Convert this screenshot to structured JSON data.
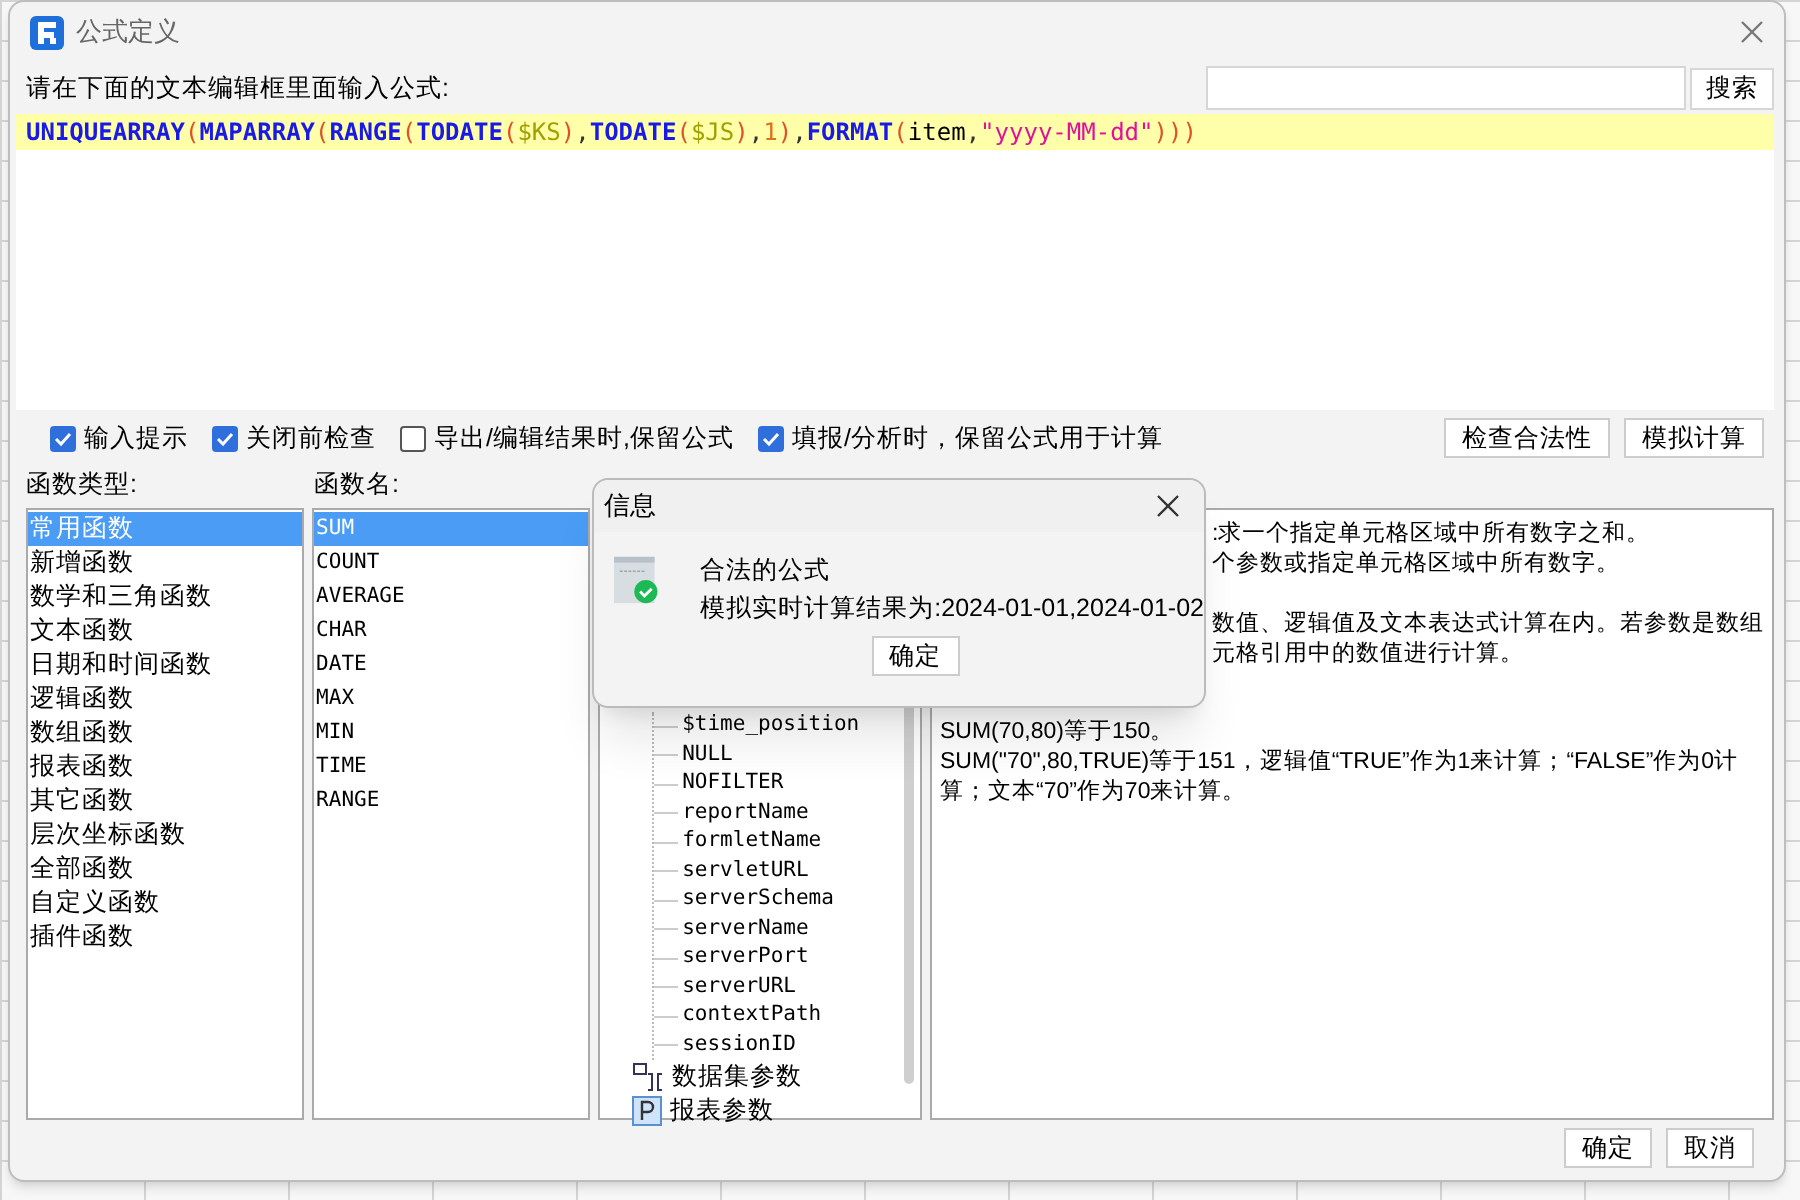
{
  "window": {
    "title": "公式定义"
  },
  "prompt": "请在下面的文本编辑框里面输入公式:",
  "search": {
    "button": "搜索"
  },
  "formula": [
    {
      "kind": "func",
      "text": "UNIQUEARRAY"
    },
    {
      "kind": "paren",
      "text": "("
    },
    {
      "kind": "func",
      "text": "MAPARRAY"
    },
    {
      "kind": "paren",
      "text": "("
    },
    {
      "kind": "func",
      "text": "RANGE"
    },
    {
      "kind": "paren",
      "text": "("
    },
    {
      "kind": "func",
      "text": "TODATE"
    },
    {
      "kind": "paren",
      "text": "("
    },
    {
      "kind": "var",
      "text": "$KS"
    },
    {
      "kind": "paren",
      "text": ")"
    },
    {
      "kind": "punct",
      "text": ","
    },
    {
      "kind": "func",
      "text": "TODATE"
    },
    {
      "kind": "paren",
      "text": "("
    },
    {
      "kind": "var",
      "text": "$JS"
    },
    {
      "kind": "paren",
      "text": ")"
    },
    {
      "kind": "punct",
      "text": ","
    },
    {
      "kind": "number",
      "text": "1"
    },
    {
      "kind": "paren",
      "text": ")"
    },
    {
      "kind": "punct",
      "text": ","
    },
    {
      "kind": "func",
      "text": "FORMAT"
    },
    {
      "kind": "paren",
      "text": "("
    },
    {
      "kind": "plain",
      "text": "item"
    },
    {
      "kind": "punct",
      "text": ","
    },
    {
      "kind": "string",
      "text": "\"yyyy-MM-dd\""
    },
    {
      "kind": "paren",
      "text": ")))"
    }
  ],
  "options": [
    {
      "label": "输入提示",
      "checked": true
    },
    {
      "label": "关闭前检查",
      "checked": true
    },
    {
      "label": "导出/编辑结果时,保留公式",
      "checked": false
    },
    {
      "label": "填报/分析时，保留公式用于计算",
      "checked": true
    }
  ],
  "actions": [
    "检查合法性",
    "模拟计算"
  ],
  "function_types": {
    "label": "函数类型:",
    "items": [
      {
        "label": "常用函数",
        "selected": true
      },
      {
        "label": "新增函数",
        "selected": false
      },
      {
        "label": "数学和三角函数",
        "selected": false
      },
      {
        "label": "文本函数",
        "selected": false
      },
      {
        "label": "日期和时间函数",
        "selected": false
      },
      {
        "label": "逻辑函数",
        "selected": false
      },
      {
        "label": "数组函数",
        "selected": false
      },
      {
        "label": "报表函数",
        "selected": false
      },
      {
        "label": "其它函数",
        "selected": false
      },
      {
        "label": "层次坐标函数",
        "selected": false
      },
      {
        "label": "全部函数",
        "selected": false
      },
      {
        "label": "自定义函数",
        "selected": false
      },
      {
        "label": "插件函数",
        "selected": false
      }
    ]
  },
  "function_names": {
    "label": "函数名:",
    "items": [
      {
        "label": "SUM",
        "selected": true
      },
      {
        "label": "COUNT",
        "selected": false
      },
      {
        "label": "AVERAGE",
        "selected": false
      },
      {
        "label": "CHAR",
        "selected": false
      },
      {
        "label": "DATE",
        "selected": false
      },
      {
        "label": "MAX",
        "selected": false
      },
      {
        "label": "MIN",
        "selected": false
      },
      {
        "label": "TIME",
        "selected": false
      },
      {
        "label": "RANGE",
        "selected": false
      }
    ]
  },
  "tree": {
    "variables": [
      "$time_position",
      "NULL",
      "NOFILTER",
      "reportName",
      "formletName",
      "servletURL",
      "serverSchema",
      "serverName",
      "serverPort",
      "serverURL",
      "contextPath",
      "sessionID"
    ],
    "groups": [
      {
        "label": "数据集参数",
        "kind": "dataset"
      },
      {
        "label": "报表参数",
        "kind": "parameter"
      }
    ]
  },
  "description": [
    [
      ":求一个指定单元格区域中所有数字之和。",
      "个参数或指定单元格区域中所有数字。"
    ],
    [
      "数值、逻辑值及文本表达式计算在内。若参数是数组",
      "元格引用中的数值进行计算。"
    ],
    [
      "SUM(70,80)等于150。",
      "SUM(\"70\",80,TRUE)等于151，逻辑值“TRUE”作为1来计算；“FALSE”作为0计算；文本“70”作为70来计算。"
    ]
  ],
  "footer": [
    "确定",
    "取消"
  ],
  "message": {
    "title": "信息",
    "lines": [
      "合法的公式",
      "模拟实时计算结果为:2024-01-01,2024-01-02"
    ],
    "button": "确定"
  }
}
